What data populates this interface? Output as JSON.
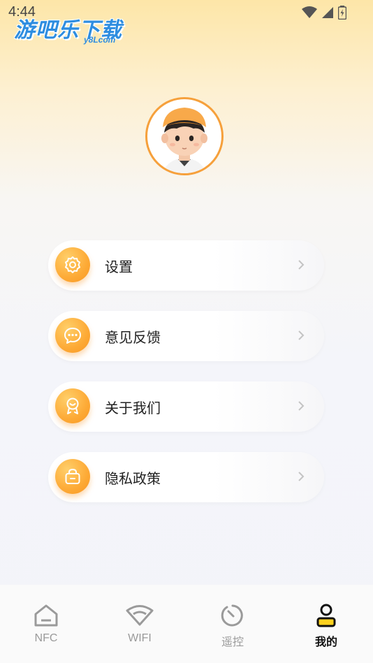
{
  "status_bar": {
    "time": "4:44",
    "icons": [
      "wifi-icon",
      "signal-icon",
      "battery-icon"
    ]
  },
  "watermark": {
    "main": "游吧乐下载",
    "sub": "y8Lcom"
  },
  "profile": {
    "avatar": "avatar-icon"
  },
  "menu": {
    "items": [
      {
        "label": "设置",
        "icon": "gear-icon"
      },
      {
        "label": "意见反馈",
        "icon": "chat-bubble-icon"
      },
      {
        "label": "关于我们",
        "icon": "badge-icon"
      },
      {
        "label": "隐私政策",
        "icon": "lock-icon"
      }
    ]
  },
  "tabbar": {
    "tabs": [
      {
        "label": "NFC",
        "icon": "home-icon",
        "active": false
      },
      {
        "label": "WIFI",
        "icon": "wifi-icon",
        "active": false
      },
      {
        "label": "遥控",
        "icon": "timer-icon",
        "active": false
      },
      {
        "label": "我的",
        "icon": "user-icon",
        "active": true
      }
    ]
  },
  "colors": {
    "accent": "#f89621",
    "accent_light": "#ffcf6a",
    "watermark_blue": "#2e8de0",
    "text_primary": "#222222",
    "text_muted": "#9a9a9a"
  }
}
